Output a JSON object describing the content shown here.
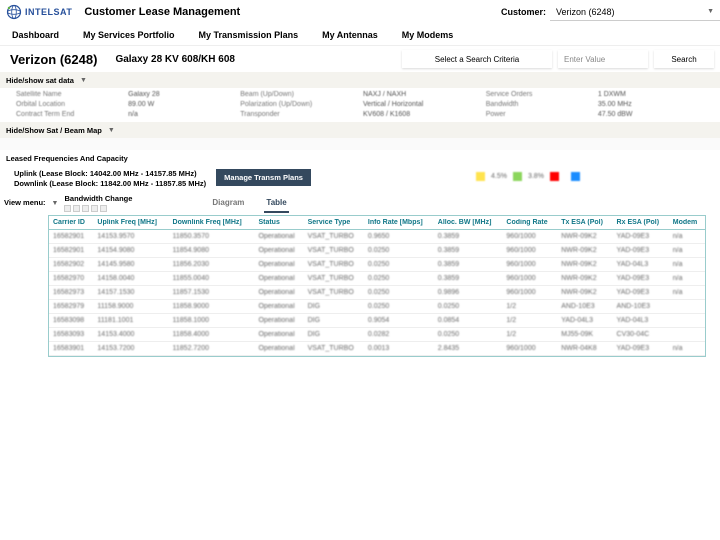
{
  "brand": {
    "name": "INTELSAT"
  },
  "app_title": "Customer Lease Management",
  "customer_label": "Customer:",
  "customer_value": "Verizon (6248)",
  "nav": [
    "Dashboard",
    "My Services Portfolio",
    "My Transmission Plans",
    "My Antennas",
    "My Modems"
  ],
  "page_title": "Verizon (6248)",
  "subtitle": "Galaxy 28 KV 608/KH 608",
  "search_criteria": "Select a Search Criteria",
  "search_placeholder": "Enter Value",
  "search_btn": "Search",
  "toggles": {
    "sat_data": "Hide/show sat data",
    "beam_map": "Hide/Show Sat / Beam Map"
  },
  "sat_data": {
    "rows": [
      [
        "Satellite Name",
        "Galaxy 28",
        "Beam (Up/Down)",
        "NAXJ / NAXH",
        "Service Orders",
        "1 DXWM"
      ],
      [
        "Orbital Location",
        "89.00 W",
        "Polarization (Up/Down)",
        "Vertical / Horizontal",
        "Bandwidth",
        "35.00 MHz"
      ],
      [
        "Contract Term End",
        "n/a",
        "Transponder",
        "KV608 / K1608",
        "Power",
        "47.50 dBW"
      ]
    ]
  },
  "section_leased": "Leased Frequencies And Capacity",
  "lease_uplink": "Uplink (Lease Block: 14042.00 MHz - 14157.85 MHz)",
  "lease_downlink": "Downlink (Lease Block: 11842.00 MHz - 11857.85 MHz)",
  "manage_btn": "Manage Transm Plans",
  "legend_items": [
    {
      "color": "#ffe34d",
      "label": "4.5%"
    },
    {
      "color": "#8bd65b",
      "label": "3.8%"
    },
    {
      "color": "#ff0000",
      "label": ""
    },
    {
      "color": "#1a8cff",
      "label": ""
    }
  ],
  "view_menu": "View menu:",
  "bw_change": "Bandwidth Change",
  "tabs": [
    "Diagram",
    "Table"
  ],
  "active_tab": 1,
  "table": {
    "headers": [
      "Carrier ID",
      "Uplink Freq [MHz]",
      "Downlink Freq [MHz]",
      "Status",
      "Service Type",
      "Info Rate [Mbps]",
      "Alloc. BW [MHz]",
      "Coding Rate",
      "Tx ESA (Pol)",
      "Rx ESA (Pol)",
      "Modem"
    ],
    "rows": [
      [
        "16582901",
        "14153.9570",
        "11850.3570",
        "Operational",
        "VSAT_TURBO",
        "0.9650",
        "0.3859",
        "960/1000",
        "NWR-09K2",
        "YAD-09E3",
        "n/a"
      ],
      [
        "16582901",
        "14154.9080",
        "11854.9080",
        "Operational",
        "VSAT_TURBO",
        "0.0250",
        "0.3859",
        "960/1000",
        "NWR-09K2",
        "YAD-09E3",
        "n/a"
      ],
      [
        "16582902",
        "14145.9580",
        "11856.2030",
        "Operational",
        "VSAT_TURBO",
        "0.0250",
        "0.3859",
        "960/1000",
        "NWR-09K2",
        "YAD-04L3",
        "n/a"
      ],
      [
        "16582970",
        "14158.0040",
        "11855.0040",
        "Operational",
        "VSAT_TURBO",
        "0.0250",
        "0.3859",
        "960/1000",
        "NWR-09K2",
        "YAD-09E3",
        "n/a"
      ],
      [
        "16582973",
        "14157.1530",
        "11857.1530",
        "Operational",
        "VSAT_TURBO",
        "0.0250",
        "0.9896",
        "960/1000",
        "NWR-09K2",
        "YAD-09E3",
        "n/a"
      ],
      [
        "16582979",
        "11158.9000",
        "11858.9000",
        "Operational",
        "DIG",
        "0.0250",
        "0.0250",
        "1/2",
        "AND-10E3",
        "AND-10E3",
        ""
      ],
      [
        "16583098",
        "11181.1001",
        "11858.1000",
        "Operational",
        "DIG",
        "0.9054",
        "0.0854",
        "1/2",
        "YAD-04L3",
        "YAD-04L3",
        ""
      ],
      [
        "16583093",
        "14153.4000",
        "11858.4000",
        "Operational",
        "DIG",
        "0.0282",
        "0.0250",
        "1/2",
        "MJ55-09K",
        "CV30-04C",
        ""
      ],
      [
        "16583901",
        "14153.7200",
        "11852.7200",
        "Operational",
        "VSAT_TURBO",
        "0.0013",
        "2.8435",
        "960/1000",
        "NWR-04K8",
        "YAD-09E3",
        "n/a"
      ]
    ]
  }
}
